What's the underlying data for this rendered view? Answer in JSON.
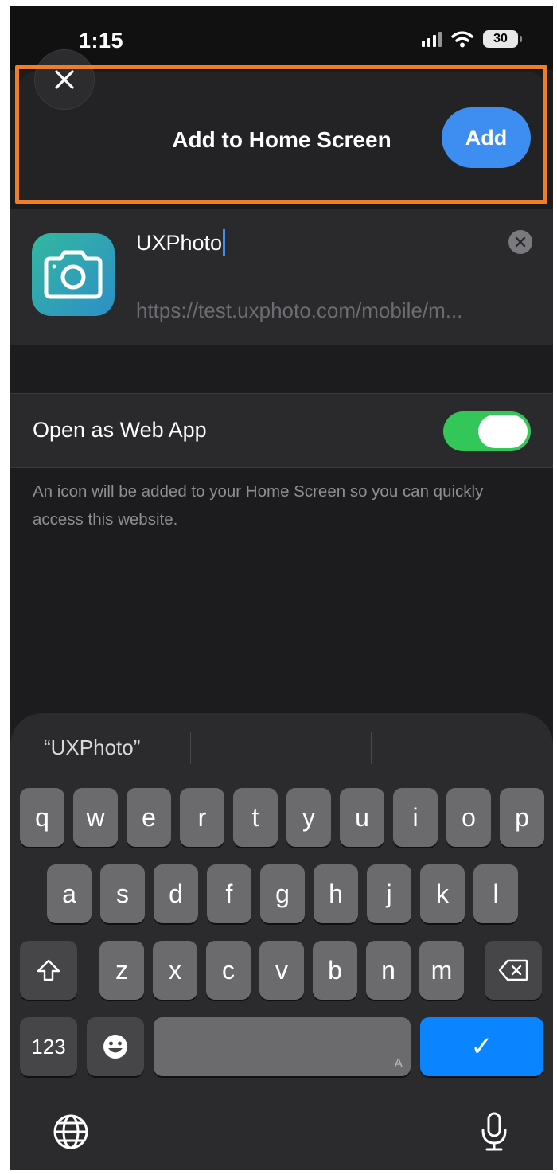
{
  "status_bar": {
    "time": "1:15",
    "battery": "30"
  },
  "header": {
    "title": "Add to Home Screen",
    "add_label": "Add"
  },
  "bookmark": {
    "name": "UXPhoto",
    "url": "https://test.uxphoto.com/mobile/m..."
  },
  "web_app": {
    "label": "Open as Web App",
    "enabled": true
  },
  "hint": "An icon will be added to your Home Screen so you can quickly access this website.",
  "keyboard": {
    "suggestions": [
      "“UXPhoto”",
      "",
      ""
    ],
    "row1": [
      "q",
      "w",
      "e",
      "r",
      "t",
      "y",
      "u",
      "i",
      "o",
      "p"
    ],
    "row2": [
      "a",
      "s",
      "d",
      "f",
      "g",
      "h",
      "j",
      "k",
      "l"
    ],
    "row3": [
      "z",
      "x",
      "c",
      "v",
      "b",
      "n",
      "m"
    ],
    "numbers_label": "123",
    "space_hint": "A",
    "done_label": "✓"
  },
  "colors": {
    "accent": "#3d8ef0",
    "toggle_on": "#33c759",
    "highlight": "#f07d28",
    "done_key": "#0a84ff"
  }
}
